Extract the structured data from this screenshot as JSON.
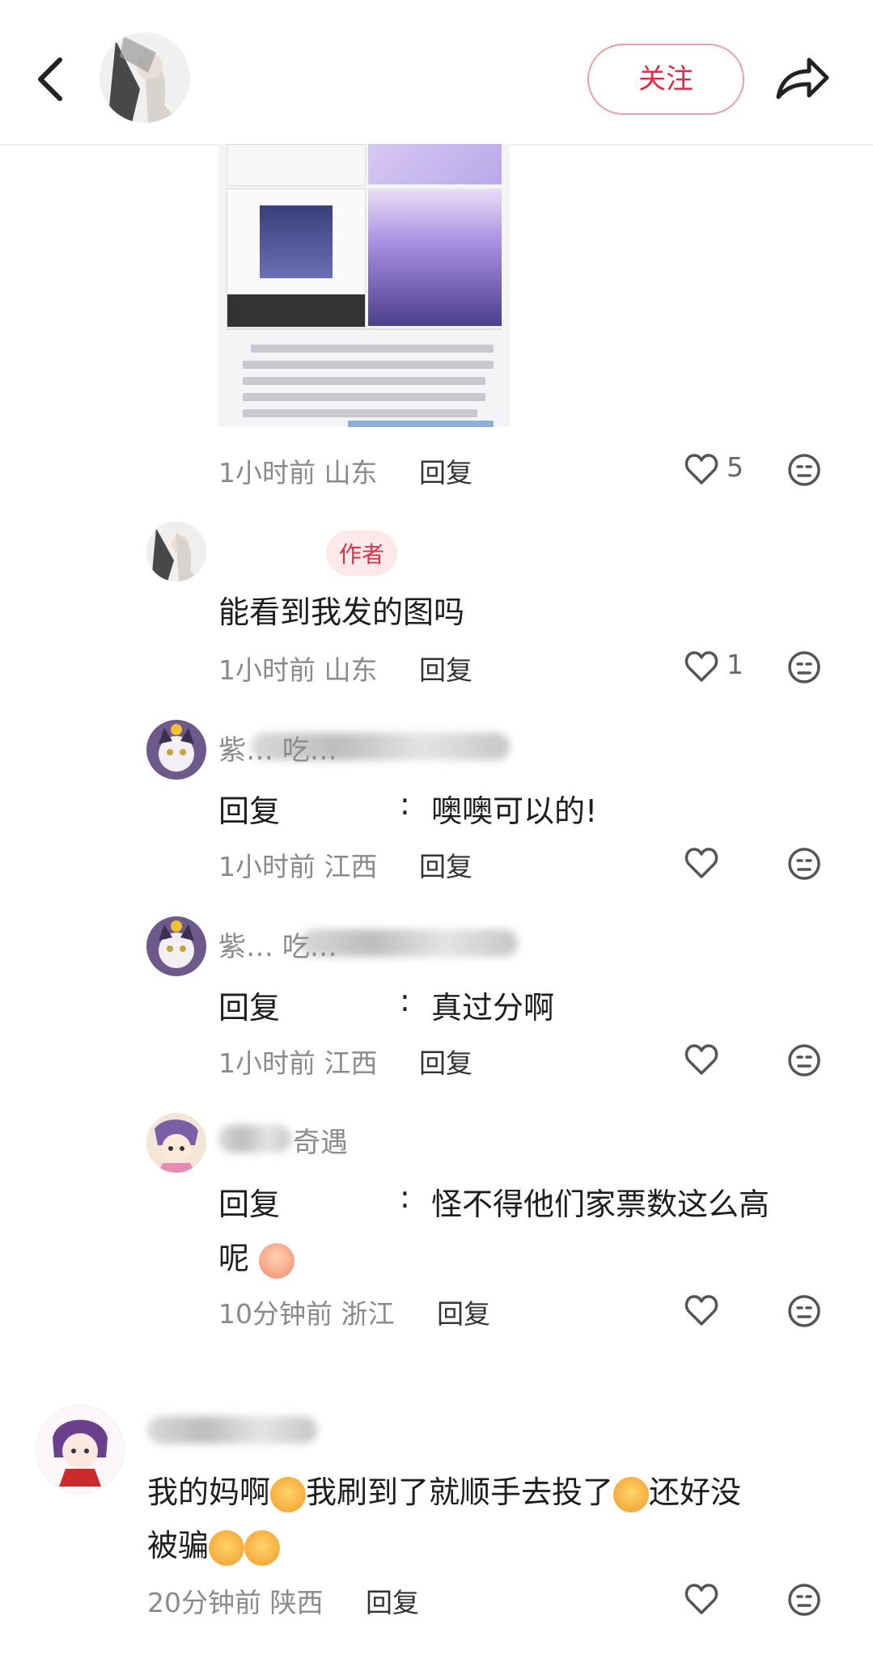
{
  "header": {
    "follow_label": "关注",
    "icons": [
      "chevron-left-icon",
      "share-arrow-icon"
    ]
  },
  "shared_image": {
    "lines": [
      "◎招揽超话 #招揽战神评选#",
      "宝宝们一的 不要扫不要扫！ 是其他男主的生日活动",
      "如图二所示：点了分享之后是为[其他男主应援]",
      "图三为点左上角看所示也为[其他男主应援]",
      "如果有点了的宝宝记得点左上角主页之后再点击解绑！",
      "图四才是我们的活动，认准图4"
    ]
  },
  "comments": [
    {
      "time": "1小时前",
      "location": "山东",
      "reply_label": "回复",
      "likes": "5"
    },
    {
      "badge": "作者",
      "text": "能看到我发的图吗",
      "time": "1小时前",
      "location": "山东",
      "reply_label": "回复",
      "likes": "1"
    },
    {
      "name": "紫…  吃…",
      "reply_prefix": "回复",
      "colon": ":",
      "text": "噢噢可以的!",
      "time": "1小时前",
      "location": "江西",
      "reply_label": "回复"
    },
    {
      "name": "紫…  吃…",
      "reply_prefix": "回复",
      "colon": ":",
      "text": "真过分啊",
      "time": "1小时前",
      "location": "江西",
      "reply_label": "回复"
    },
    {
      "name": "奇遇",
      "reply_prefix": "回复",
      "colon": ":",
      "text_line1": "怪不得他们家票数这么高",
      "text_line2": "呢",
      "time": "10分钟前",
      "location": "浙江",
      "reply_label": "回复"
    },
    {
      "text_parts": [
        "我的妈啊",
        "我刷到了就顺手去投了",
        "还好没",
        "被骗"
      ],
      "time": "20分钟前",
      "location": "陕西",
      "reply_label": "回复"
    }
  ],
  "colors": {
    "accent": "#e02d45",
    "meta": "#8a8a8a",
    "badge_bg": "#fde8ea"
  }
}
